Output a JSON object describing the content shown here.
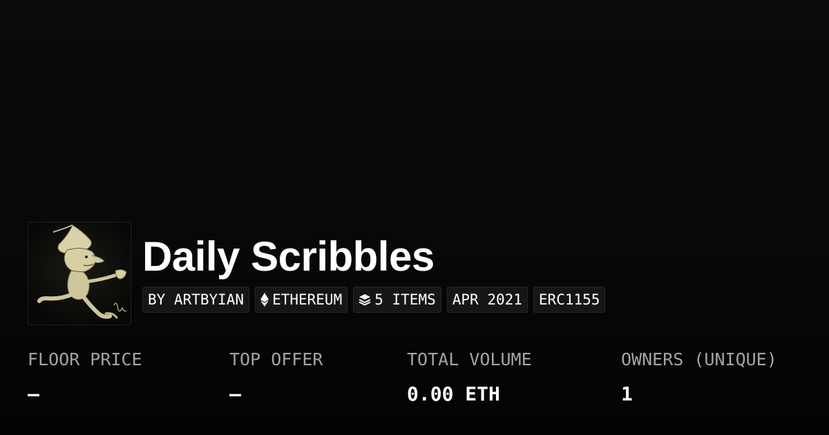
{
  "collection": {
    "title": "Daily Scribbles",
    "avatar_icon": "scribble-artwork-image"
  },
  "chips": [
    {
      "label": "BY ARTBYIAN",
      "icon": null
    },
    {
      "label": "ETHEREUM",
      "icon": "ethereum-icon"
    },
    {
      "label": "5 ITEMS",
      "icon": "layers-icon"
    },
    {
      "label": "APR 2021",
      "icon": null
    },
    {
      "label": "ERC1155",
      "icon": null
    }
  ],
  "stats": [
    {
      "label": "FLOOR PRICE",
      "value": "—"
    },
    {
      "label": "TOP OFFER",
      "value": "—"
    },
    {
      "label": "TOTAL VOLUME",
      "value": "0.00 ETH"
    },
    {
      "label": "OWNERS (UNIQUE)",
      "value": "1"
    }
  ],
  "colors": {
    "background": "#0b0b0b",
    "chip_background": "#161616",
    "label_gray": "#a4a4a4",
    "text": "#ffffff"
  }
}
